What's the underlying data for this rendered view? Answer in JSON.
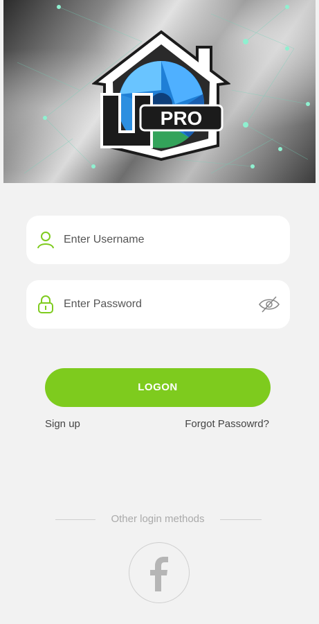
{
  "logo": {
    "text": "PRO",
    "icon": "u-pro-house-logo"
  },
  "login": {
    "username_placeholder": "Enter Username",
    "password_placeholder": "Enter Password",
    "username_icon": "user-icon",
    "password_icon": "lock-icon",
    "visibility_icon": "eye-off-icon",
    "logon_label": "LOGON",
    "signup_label": "Sign up",
    "forgot_label": "Forgot Passowrd?"
  },
  "other": {
    "label": "Other login methods",
    "facebook_icon": "facebook-icon"
  },
  "colors": {
    "accent": "#7ecb1e",
    "background": "#f2f2f2",
    "field": "#ffffff"
  }
}
